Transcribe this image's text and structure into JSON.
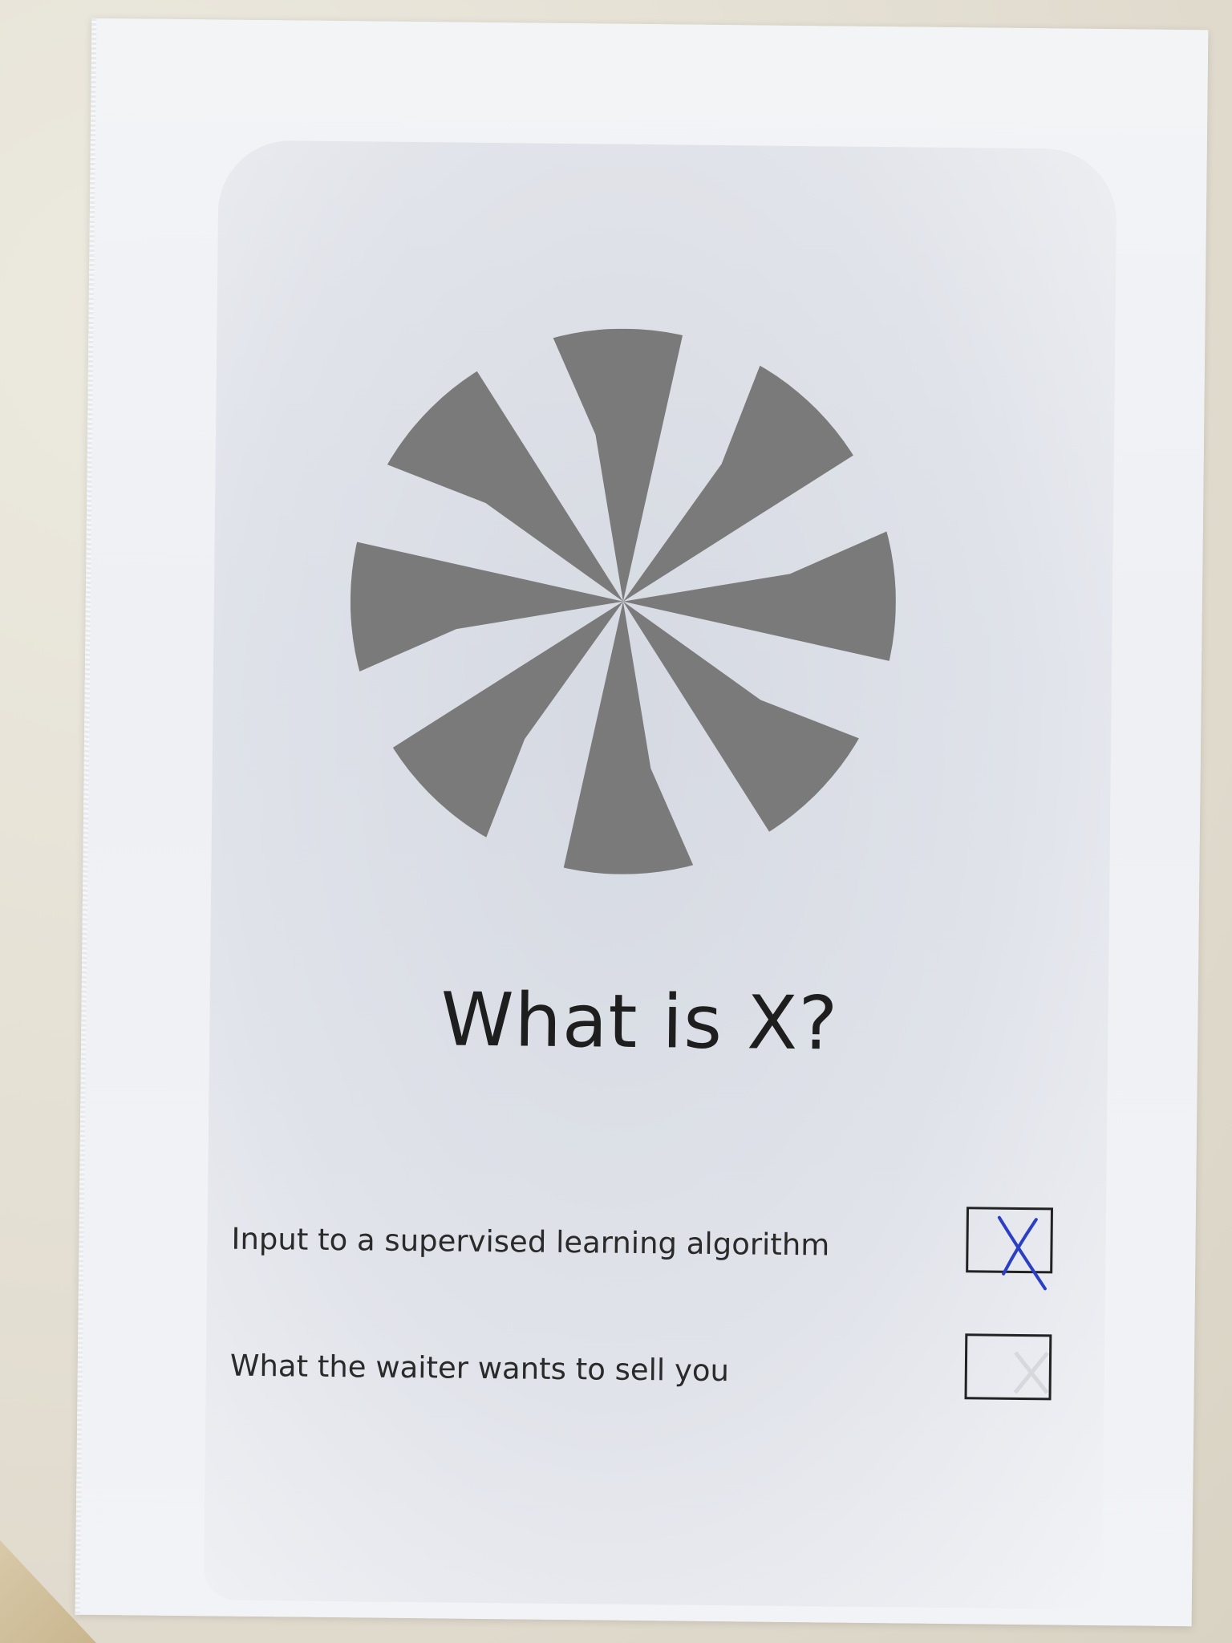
{
  "question": {
    "title": "What is X?"
  },
  "options": [
    {
      "label": "Input to a supervised learning algorithm",
      "checked": true,
      "mark_color": "#2a3fc4"
    },
    {
      "label": "What the waiter wants to sell you",
      "checked": false
    }
  ],
  "logo": {
    "icon": "radial-pinwheel-logo",
    "color": "#7a7a7a"
  },
  "colors": {
    "paper": "#f0f1f4",
    "background": "#e4e0d4",
    "text": "#1e1e1e"
  }
}
